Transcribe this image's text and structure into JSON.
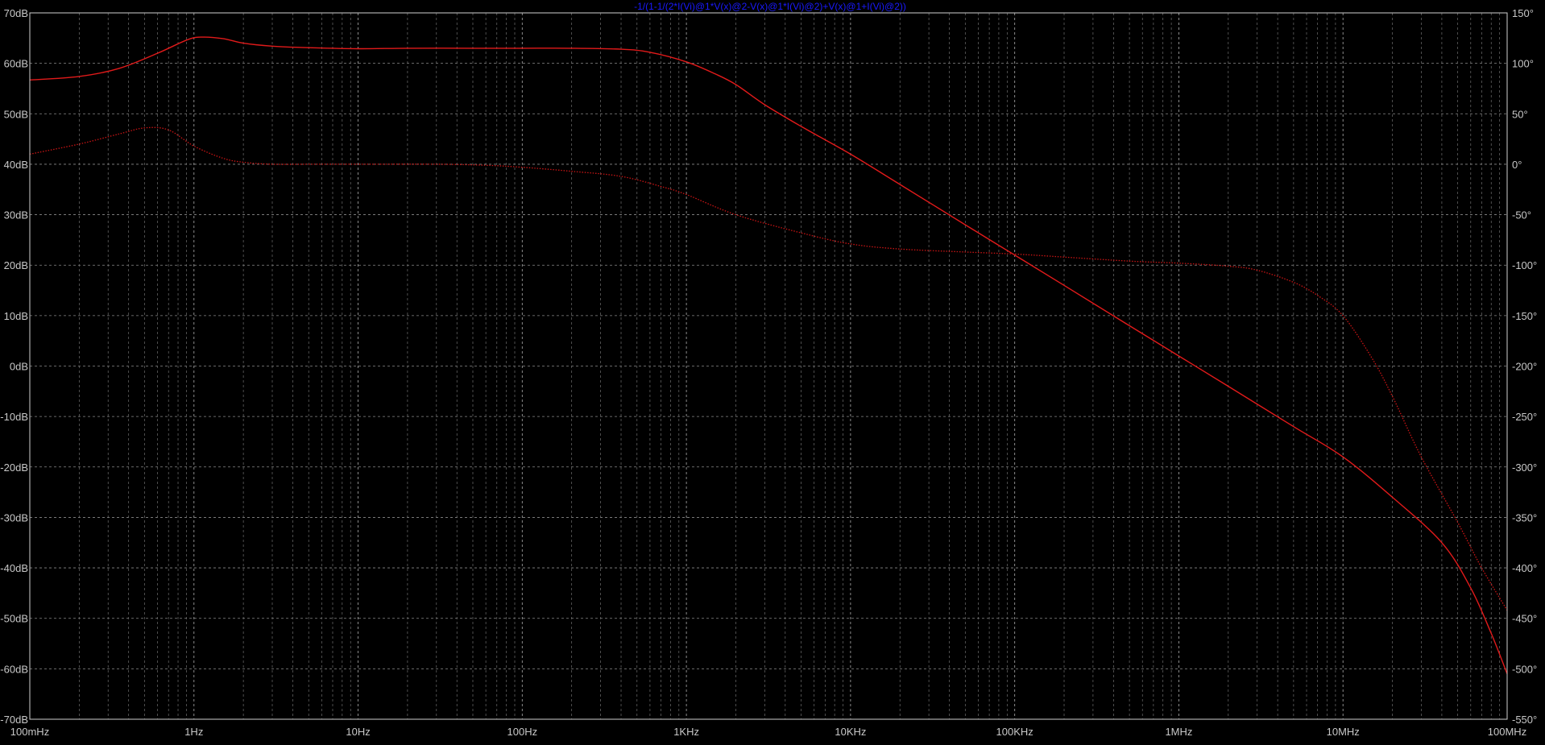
{
  "chart_data": {
    "type": "line",
    "title": "-1/(1-1/(2*I(Vi)@1*V(x)@2-V(x)@1*I(Vi)@2)+V(x)@1+I(Vi)@2))",
    "x_scale": "log",
    "xlim_hz": [
      0.1,
      100000000
    ],
    "x_tick_labels": [
      "100mHz",
      "1Hz",
      "10Hz",
      "100Hz",
      "1KHz",
      "10KHz",
      "100KHz",
      "1MHz",
      "10MHz",
      "100MHz"
    ],
    "x_tick_values": [
      0.1,
      1,
      10,
      100,
      1000,
      10000,
      100000,
      1000000,
      10000000,
      100000000
    ],
    "y_left": {
      "unit": "dB",
      "ylim": [
        -70,
        70
      ],
      "tick_labels": [
        "70dB",
        "60dB",
        "50dB",
        "40dB",
        "30dB",
        "20dB",
        "10dB",
        "0dB",
        "-10dB",
        "-20dB",
        "-30dB",
        "-40dB",
        "-50dB",
        "-60dB",
        "-70dB"
      ],
      "tick_values": [
        70,
        60,
        50,
        40,
        30,
        20,
        10,
        0,
        -10,
        -20,
        -30,
        -40,
        -50,
        -60,
        -70
      ]
    },
    "y_right": {
      "unit": "°",
      "ylim": [
        -550,
        150
      ],
      "tick_labels": [
        "150°",
        "100°",
        "50°",
        "0°",
        "-50°",
        "-100°",
        "-150°",
        "-200°",
        "-250°",
        "-300°",
        "-350°",
        "-400°",
        "-450°",
        "-500°",
        "-550°"
      ],
      "tick_values": [
        150,
        100,
        50,
        0,
        -50,
        -100,
        -150,
        -200,
        -250,
        -300,
        -350,
        -400,
        -450,
        -500,
        -550
      ]
    },
    "grid": true,
    "series": [
      {
        "role": "magnitude",
        "axis": "left",
        "style": "solid",
        "color": "#e11a1a",
        "x": [
          0.1,
          0.2,
          0.35,
          0.6,
          0.9,
          1.1,
          1.5,
          2,
          3,
          5,
          10,
          20,
          50,
          100,
          200,
          400,
          600,
          1000,
          1500,
          2000,
          3000,
          5000,
          10000,
          20000,
          50000,
          100000,
          200000,
          500000,
          1000000,
          2000000,
          5000000,
          10000000,
          20000000,
          40000000,
          60000000,
          80000000,
          100000000
        ],
        "y": [
          56.7,
          57.4,
          59.0,
          62.0,
          64.6,
          65.2,
          64.9,
          64.0,
          63.4,
          63.1,
          62.9,
          63.0,
          63.0,
          63.0,
          63.0,
          62.8,
          62.2,
          60.3,
          57.9,
          55.8,
          51.8,
          47.5,
          42.0,
          36.0,
          28.0,
          22.0,
          16.0,
          8.0,
          2.0,
          -4.0,
          -12.0,
          -18.0,
          -26.0,
          -35.0,
          -44.0,
          -53.0,
          -61.0
        ]
      },
      {
        "role": "phase",
        "axis": "right",
        "style": "dotted",
        "color": "#c81414",
        "x": [
          0.1,
          0.2,
          0.35,
          0.5,
          0.7,
          1,
          1.5,
          2,
          3,
          5,
          10,
          30,
          60,
          100,
          200,
          400,
          700,
          1000,
          2000,
          5000,
          10000,
          20000,
          50000,
          100000,
          200000,
          500000,
          1000000,
          2000000,
          3000000,
          5000000,
          7000000,
          10000000,
          15000000,
          20000000,
          30000000,
          50000000,
          70000000,
          100000000
        ],
        "y": [
          10,
          20,
          30,
          36,
          34,
          18,
          6,
          2,
          0,
          0,
          0,
          0,
          -1,
          -3,
          -7,
          -12,
          -22,
          -30,
          -50,
          -68,
          -79,
          -84,
          -87,
          -89,
          -92,
          -96,
          -98,
          -101,
          -105,
          -117,
          -130,
          -150,
          -192,
          -230,
          -290,
          -355,
          -400,
          -442
        ]
      }
    ]
  }
}
